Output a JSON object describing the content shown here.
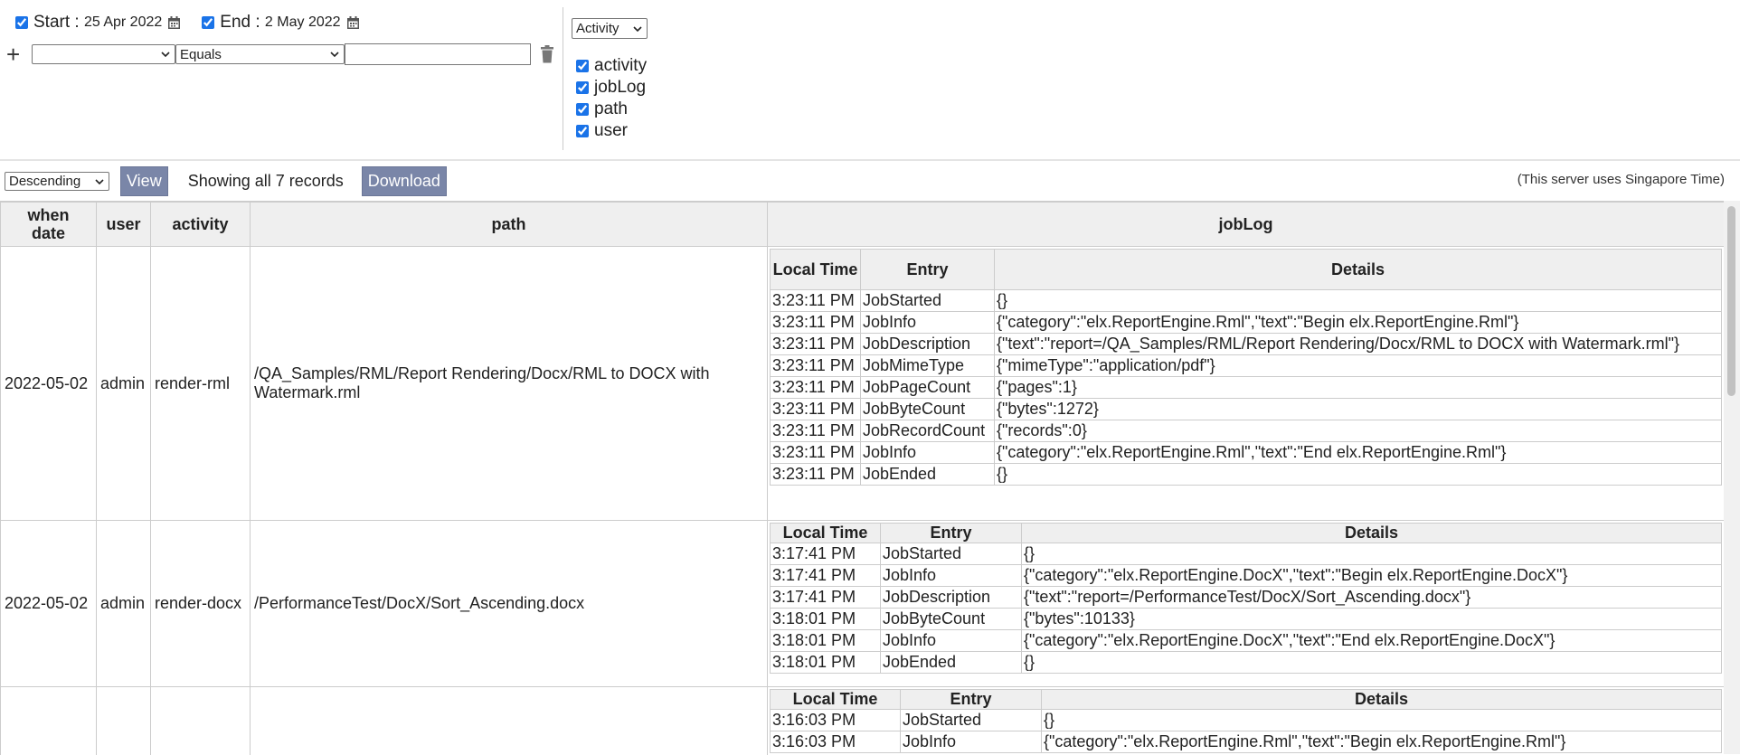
{
  "filters": {
    "start_checked": true,
    "start_label": "Start :",
    "start_date": "25 Apr 2022",
    "end_checked": true,
    "end_label": "End :",
    "end_date": "2 May 2022",
    "field_value": "",
    "operator_value": "Equals",
    "text_value": ""
  },
  "activity_select": "Activity",
  "columns": [
    "activity",
    "jobLog",
    "path",
    "user"
  ],
  "toolbar": {
    "order": "Descending",
    "view_label": "View",
    "showing_text": "Showing all 7 records",
    "download_label": "Download",
    "server_note": "(This server uses Singapore Time)"
  },
  "table": {
    "headers": {
      "when": "when date",
      "user": "user",
      "activity": "activity",
      "path": "path",
      "joblog": "jobLog"
    },
    "log_headers": {
      "time": "Local Time",
      "entry": "Entry",
      "details": "Details"
    },
    "rows": [
      {
        "date": "2022-05-02",
        "user": "admin",
        "activity": "render-rml",
        "path": "/QA_Samples/RML/Report Rendering/Docx/RML to DOCX with Watermark.rml",
        "log": [
          {
            "time": "3:23:11 PM",
            "entry": "JobStarted",
            "details": "{}"
          },
          {
            "time": "3:23:11 PM",
            "entry": "JobInfo",
            "details": "{\"category\":\"elx.ReportEngine.Rml\",\"text\":\"Begin elx.ReportEngine.Rml\"}"
          },
          {
            "time": "3:23:11 PM",
            "entry": "JobDescription",
            "details": "{\"text\":\"report=/QA_Samples/RML/Report Rendering/Docx/RML to DOCX with Watermark.rml\"}"
          },
          {
            "time": "3:23:11 PM",
            "entry": "JobMimeType",
            "details": "{\"mimeType\":\"application/pdf\"}"
          },
          {
            "time": "3:23:11 PM",
            "entry": "JobPageCount",
            "details": "{\"pages\":1}"
          },
          {
            "time": "3:23:11 PM",
            "entry": "JobByteCount",
            "details": "{\"bytes\":1272}"
          },
          {
            "time": "3:23:11 PM",
            "entry": "JobRecordCount",
            "details": "{\"records\":0}"
          },
          {
            "time": "3:23:11 PM",
            "entry": "JobInfo",
            "details": "{\"category\":\"elx.ReportEngine.Rml\",\"text\":\"End elx.ReportEngine.Rml\"}"
          },
          {
            "time": "3:23:11 PM",
            "entry": "JobEnded",
            "details": "{}"
          }
        ]
      },
      {
        "date": "2022-05-02",
        "user": "admin",
        "activity": "render-docx",
        "path": "/PerformanceTest/DocX/Sort_Ascending.docx",
        "log": [
          {
            "time": "3:17:41 PM",
            "entry": "JobStarted",
            "details": "{}"
          },
          {
            "time": "3:17:41 PM",
            "entry": "JobInfo",
            "details": "{\"category\":\"elx.ReportEngine.DocX\",\"text\":\"Begin elx.ReportEngine.DocX\"}"
          },
          {
            "time": "3:17:41 PM",
            "entry": "JobDescription",
            "details": "{\"text\":\"report=/PerformanceTest/DocX/Sort_Ascending.docx\"}"
          },
          {
            "time": "3:18:01 PM",
            "entry": "JobByteCount",
            "details": "{\"bytes\":10133}"
          },
          {
            "time": "3:18:01 PM",
            "entry": "JobInfo",
            "details": "{\"category\":\"elx.ReportEngine.DocX\",\"text\":\"End elx.ReportEngine.DocX\"}"
          },
          {
            "time": "3:18:01 PM",
            "entry": "JobEnded",
            "details": "{}"
          }
        ]
      },
      {
        "date": "",
        "user": "",
        "activity": "",
        "path": "",
        "log": [
          {
            "time": "3:16:03 PM",
            "entry": "JobStarted",
            "details": "{}"
          },
          {
            "time": "3:16:03 PM",
            "entry": "JobInfo",
            "details": "{\"category\":\"elx.ReportEngine.Rml\",\"text\":\"Begin elx.ReportEngine.Rml\"}"
          }
        ]
      }
    ]
  },
  "icons": {
    "calendar": "calendar-icon",
    "plus": "add-condition-icon",
    "trash": "trash-icon",
    "chevron": "chevron-down-icon"
  },
  "colors": {
    "button_bg": "#7a86a8",
    "header_bg": "#efefef",
    "border": "#cccccc"
  }
}
